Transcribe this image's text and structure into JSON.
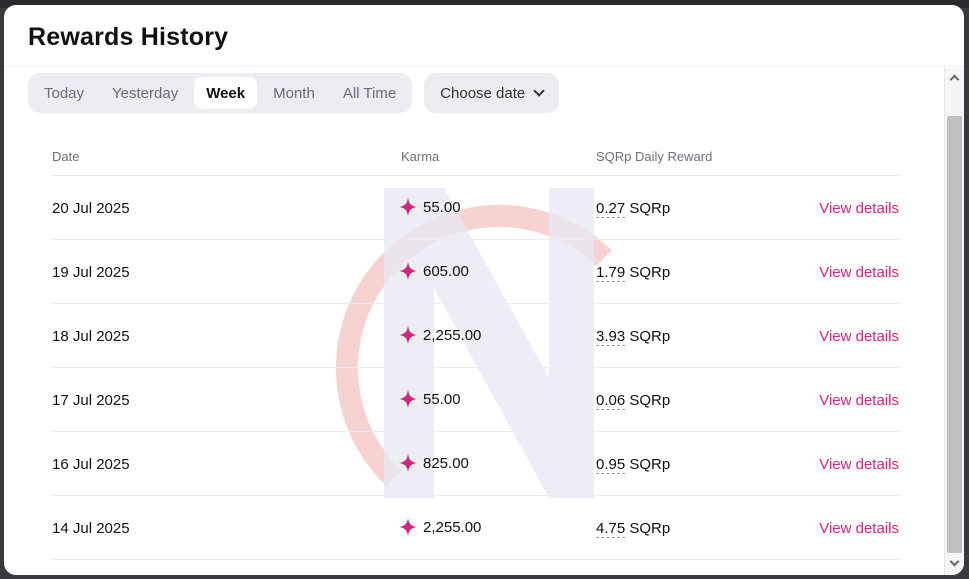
{
  "modal": {
    "title": "Rewards History"
  },
  "filters": {
    "periods": [
      "Today",
      "Yesterday",
      "Week",
      "Month",
      "All Time"
    ],
    "active_period": "Week",
    "date_picker_label": "Choose date"
  },
  "table": {
    "headers": {
      "date": "Date",
      "karma": "Karma",
      "reward": "SQRp Daily Reward"
    },
    "action_label": "View details",
    "rows": [
      {
        "date": "20 Jul 2025",
        "karma": "55.00",
        "reward": "0.27",
        "unit": "SQRp"
      },
      {
        "date": "19 Jul 2025",
        "karma": "605.00",
        "reward": "1.79",
        "unit": "SQRp"
      },
      {
        "date": "18 Jul 2025",
        "karma": "2,255.00",
        "reward": "3.93",
        "unit": "SQRp"
      },
      {
        "date": "17 Jul 2025",
        "karma": "55.00",
        "reward": "0.06",
        "unit": "SQRp"
      },
      {
        "date": "16 Jul 2025",
        "karma": "825.00",
        "reward": "0.95",
        "unit": "SQRp"
      },
      {
        "date": "14 Jul 2025",
        "karma": "2,255.00",
        "reward": "4.75",
        "unit": "SQRp"
      }
    ]
  },
  "colors": {
    "accent": "#d6247d",
    "karma_icon": "#d6247d",
    "segment_bg": "#ececf1"
  },
  "icons": {
    "karma": "sparkle-icon",
    "date_picker": "chevron-down-icon"
  }
}
